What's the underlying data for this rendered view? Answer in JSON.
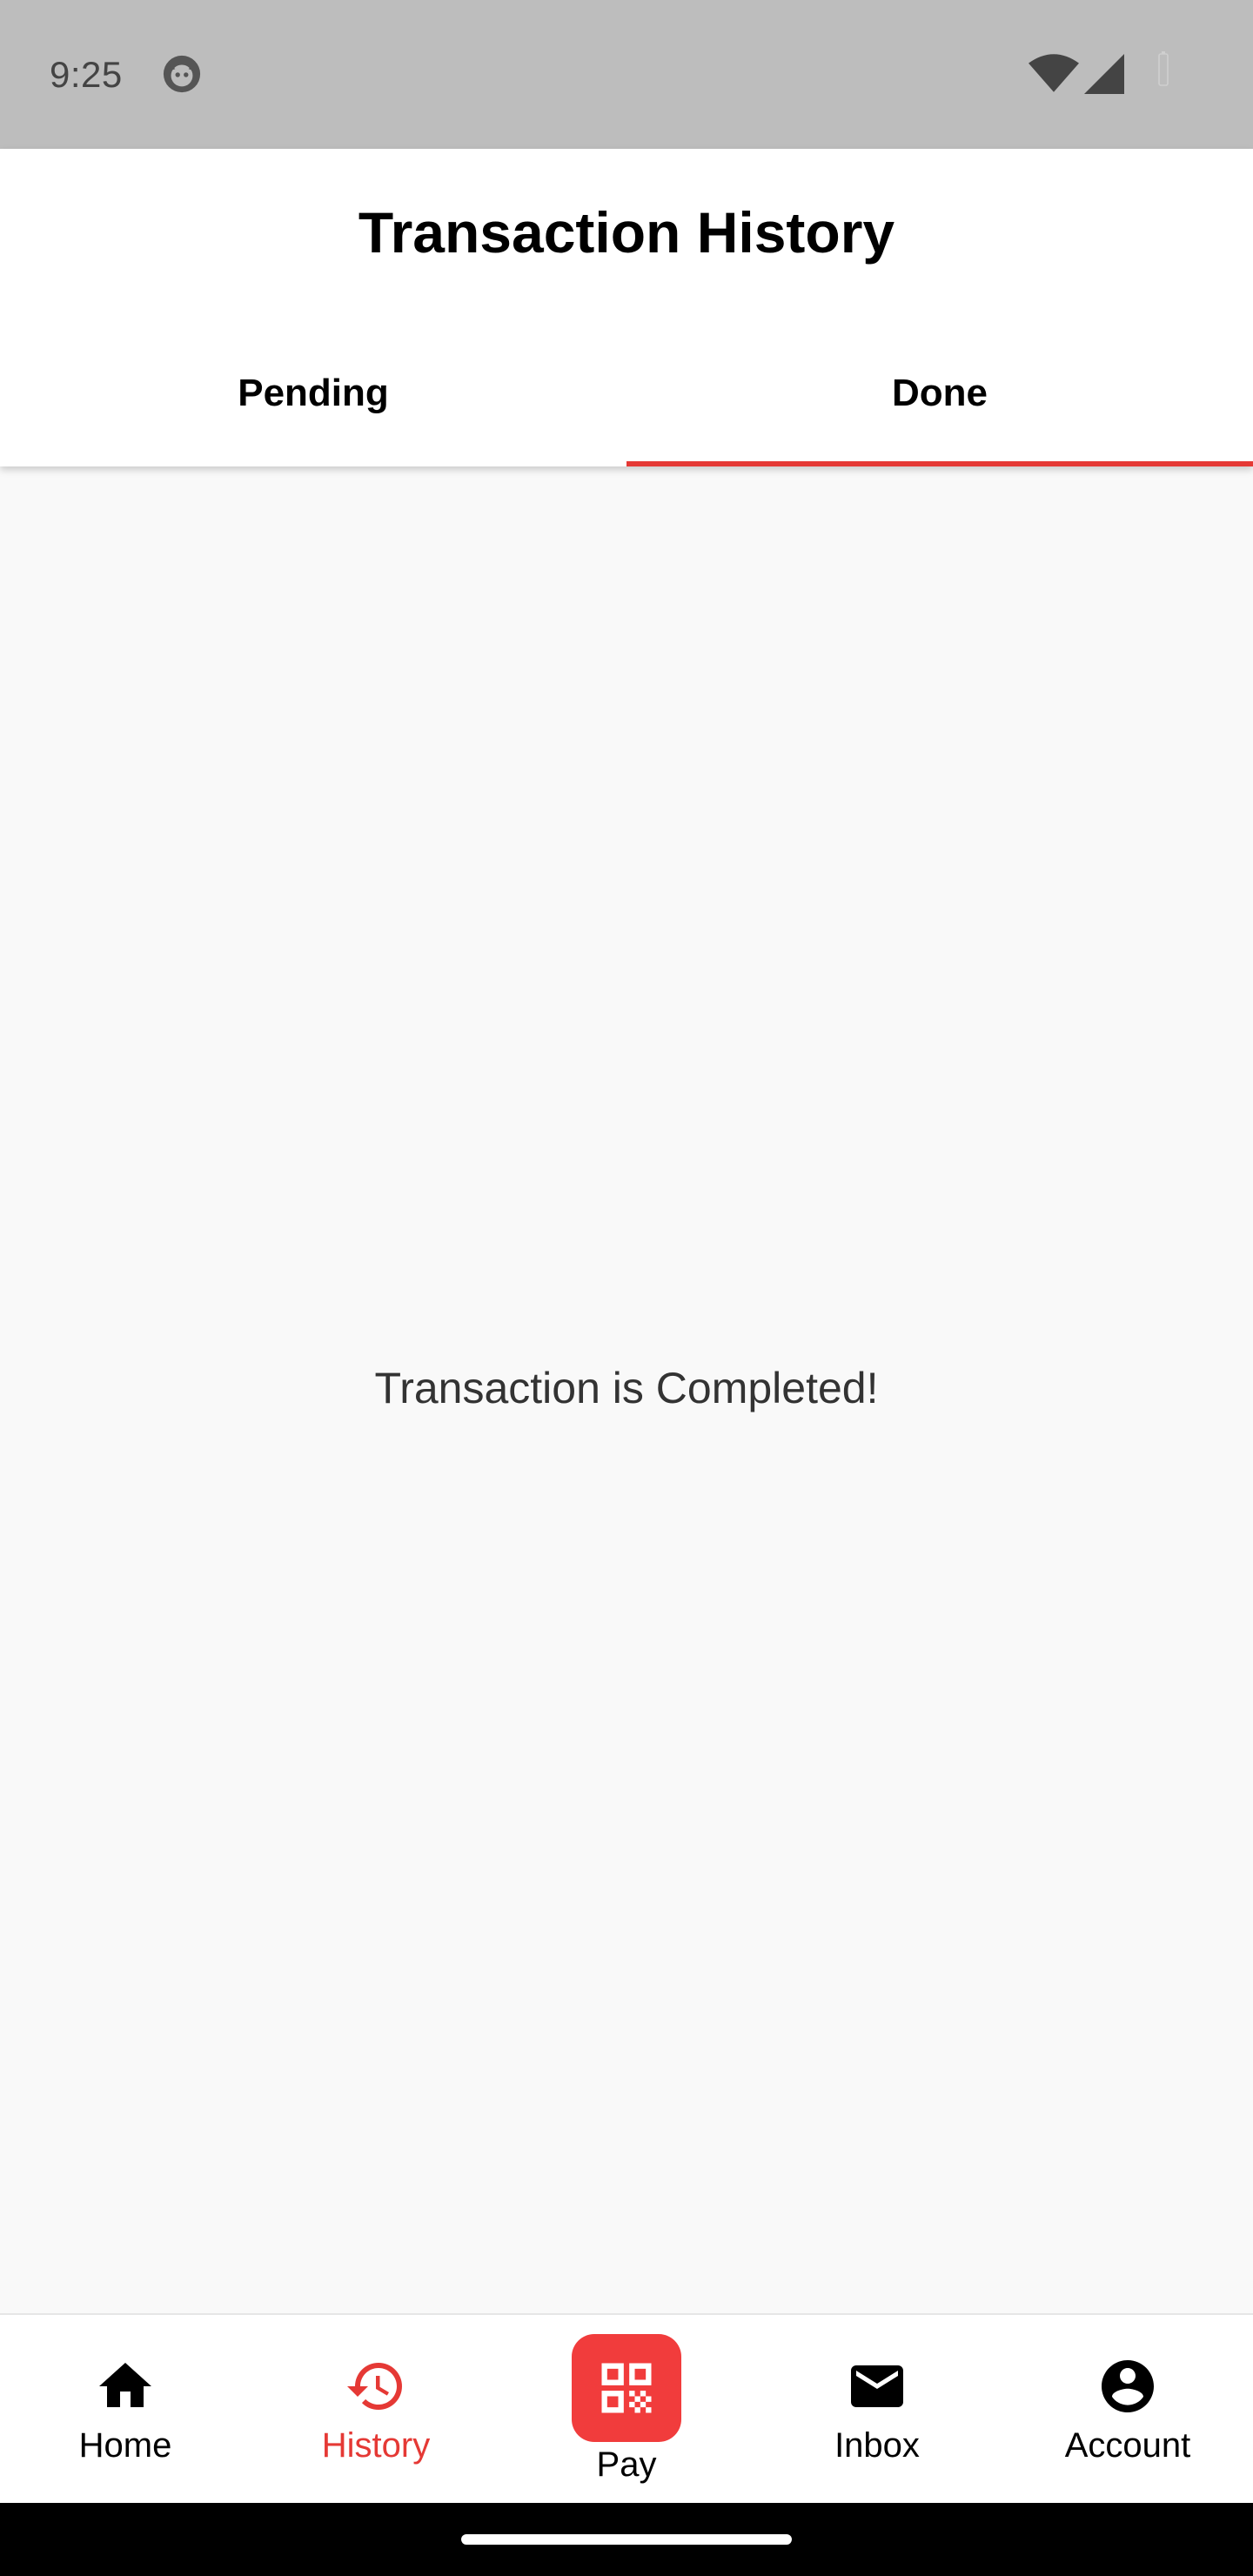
{
  "status_bar": {
    "time": "9:25"
  },
  "header": {
    "title": "Transaction History",
    "tabs": [
      {
        "label": "Pending",
        "selected": false
      },
      {
        "label": "Done",
        "selected": true
      }
    ]
  },
  "content": {
    "message": "Transaction is Completed!"
  },
  "bottom_nav": {
    "items": [
      {
        "label": "Home",
        "icon": "home-icon",
        "active": false
      },
      {
        "label": "History",
        "icon": "history-icon",
        "active": true
      },
      {
        "label": "Pay",
        "icon": "qr-code-icon",
        "active": false
      },
      {
        "label": "Inbox",
        "icon": "mail-icon",
        "active": false
      },
      {
        "label": "Account",
        "icon": "account-circle-icon",
        "active": false
      }
    ]
  },
  "colors": {
    "accent": "#e53935",
    "pay_tile": "#f13c3c",
    "status_bar": "#bdbdbd",
    "background": "#f9f9f9"
  }
}
